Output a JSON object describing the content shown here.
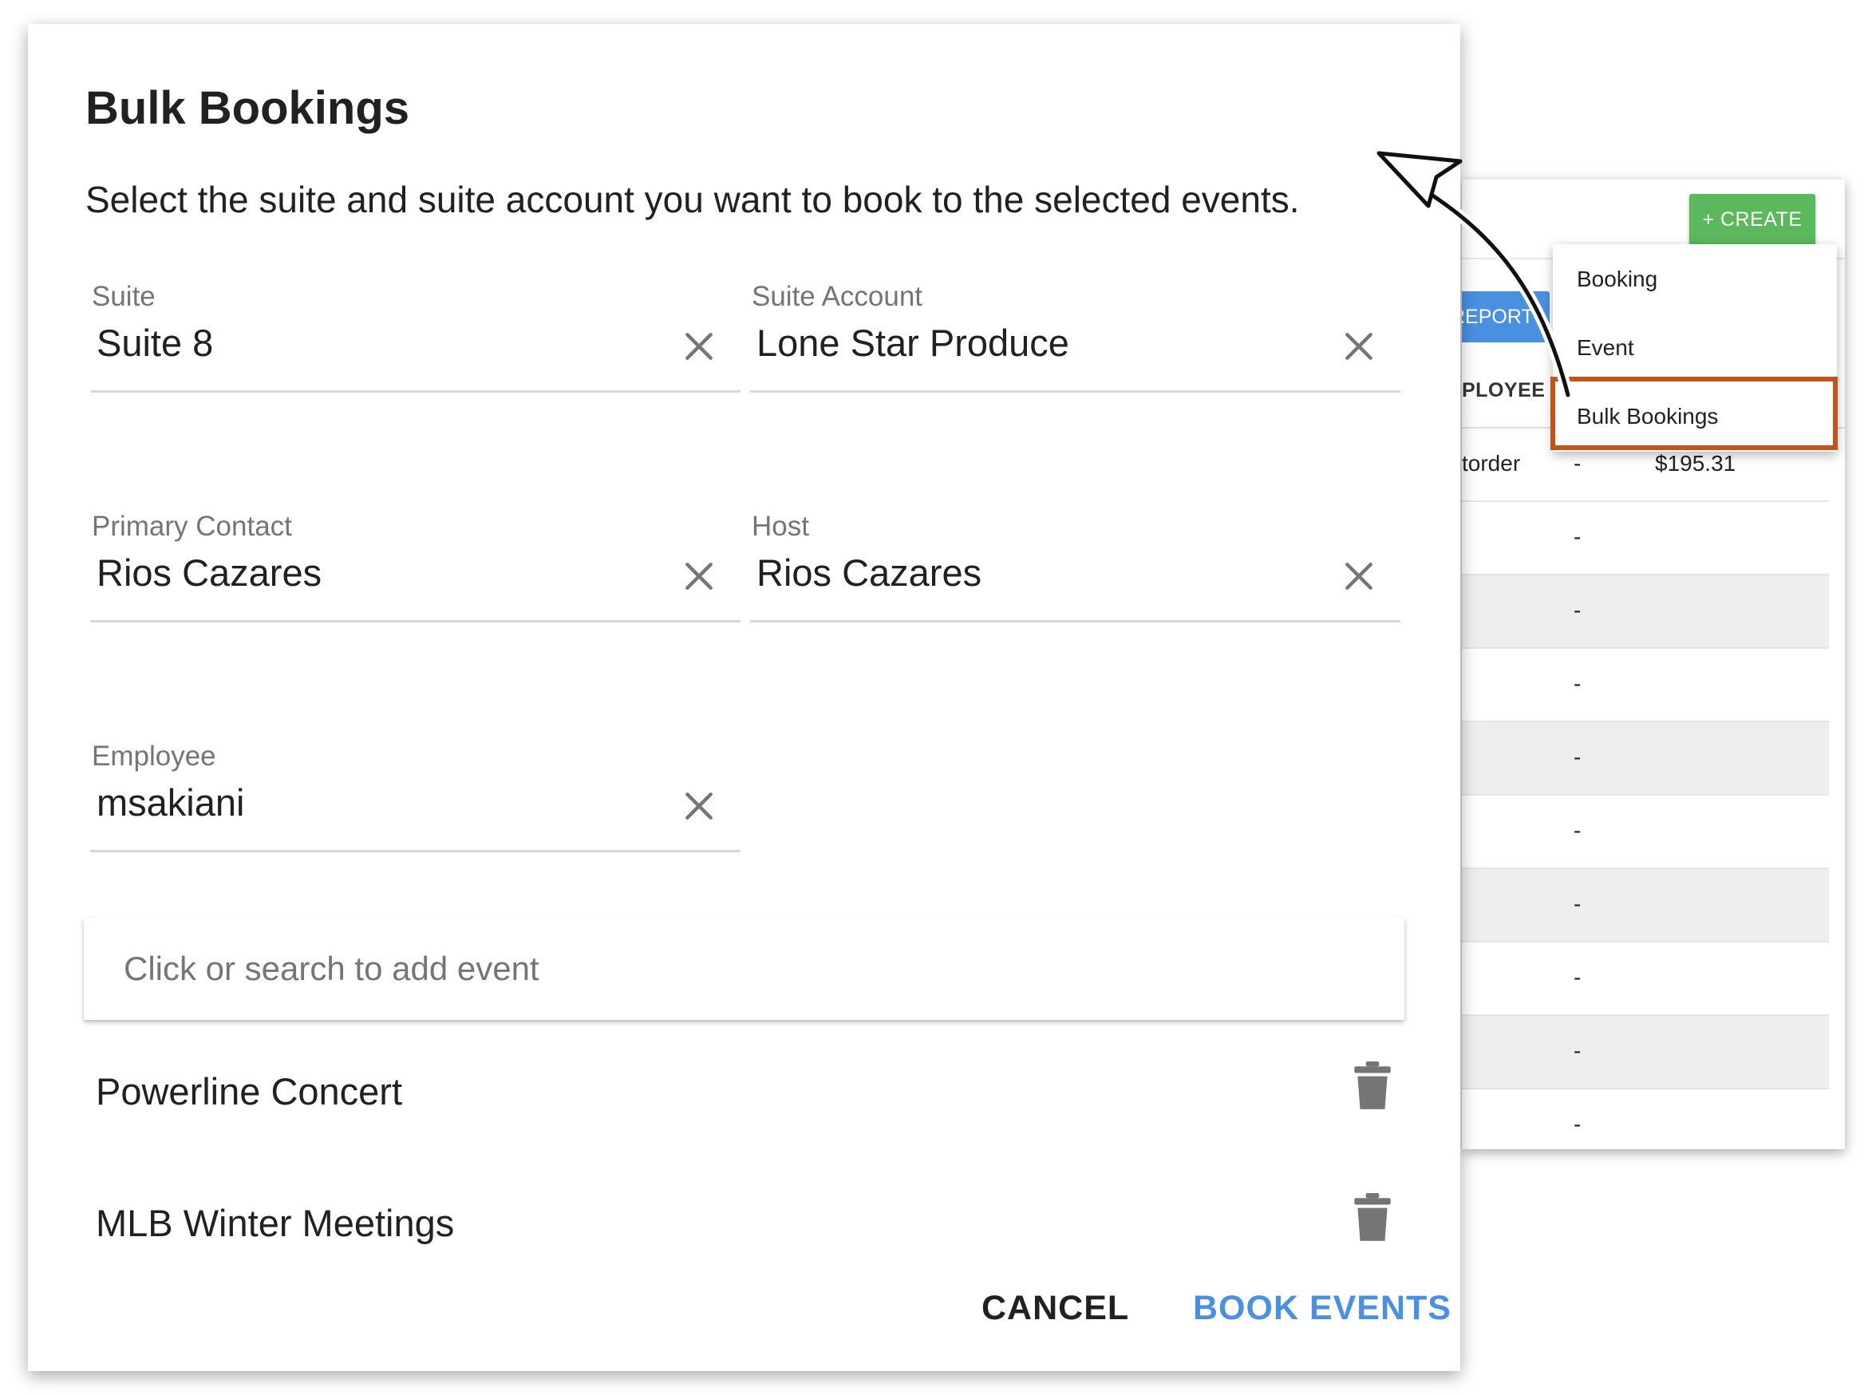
{
  "background": {
    "create_label": "+ CREATE",
    "report_label": "REPORT",
    "column_header": "PLOYEE",
    "rows": [
      {
        "a": "torder",
        "b": "-",
        "c": "$195.31"
      },
      {
        "a": "",
        "b": "-",
        "c": ""
      },
      {
        "a": "",
        "b": "-",
        "c": ""
      },
      {
        "a": "",
        "b": "-",
        "c": ""
      },
      {
        "a": "",
        "b": "-",
        "c": ""
      },
      {
        "a": "",
        "b": "-",
        "c": ""
      },
      {
        "a": "",
        "b": "-",
        "c": ""
      },
      {
        "a": "",
        "b": "-",
        "c": ""
      },
      {
        "a": "",
        "b": "-",
        "c": ""
      },
      {
        "a": "",
        "b": "-",
        "c": ""
      }
    ]
  },
  "dropdown": {
    "items": [
      "Booking",
      "Event",
      "Bulk Bookings"
    ]
  },
  "dialog": {
    "title": "Bulk Bookings",
    "subtitle": "Select the suite and suite account you want to book to the selected events.",
    "fields": {
      "suite": {
        "label": "Suite",
        "value": "Suite 8"
      },
      "suite_account": {
        "label": "Suite Account",
        "value": "Lone Star Produce"
      },
      "primary_contact": {
        "label": "Primary Contact",
        "value": "Rios Cazares"
      },
      "host": {
        "label": "Host",
        "value": "Rios Cazares"
      },
      "employee": {
        "label": "Employee",
        "value": "msakiani"
      }
    },
    "search": {
      "placeholder": "Click or search to add event"
    },
    "events": [
      "Powerline Concert",
      "MLB Winter Meetings"
    ],
    "cancel_label": "CANCEL",
    "book_label": "BOOK EVENTS"
  },
  "colors": {
    "accent_blue": "#4a90e2",
    "create_green": "#5cb85c",
    "highlight_orange": "#c1541b"
  }
}
